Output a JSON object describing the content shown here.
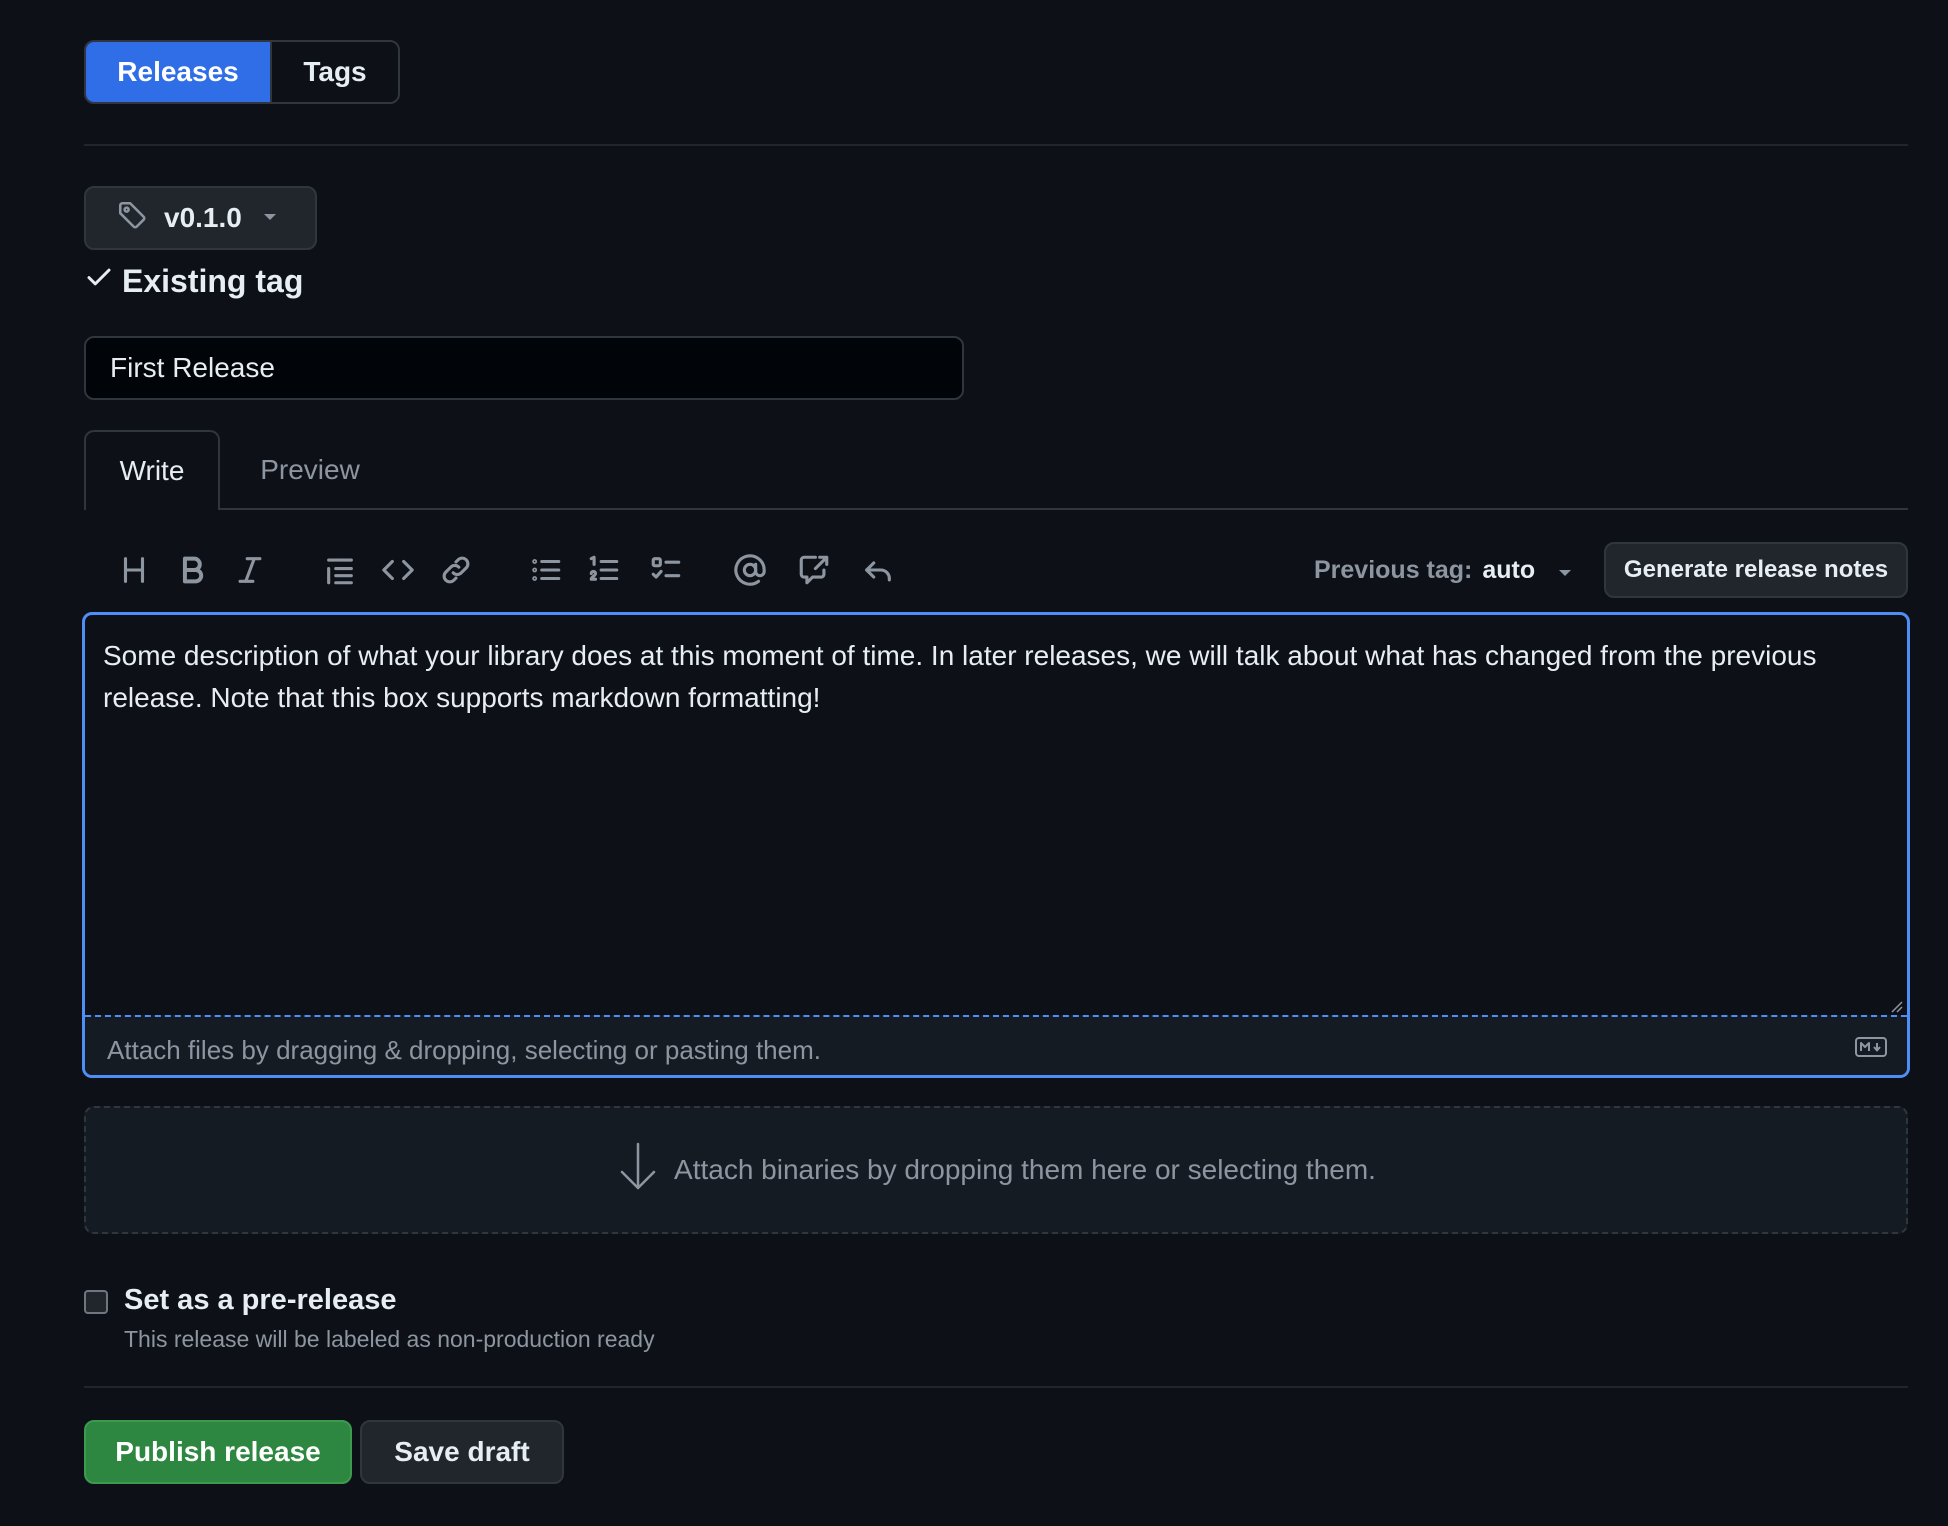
{
  "nav": {
    "releases_label": "Releases",
    "tags_label": "Tags",
    "active": "Releases"
  },
  "tag_picker": {
    "value": "v0.1.0",
    "icon": "tag-icon",
    "status_label": "Existing tag"
  },
  "release_title": {
    "value": "First Release"
  },
  "editor_tabs": {
    "write_label": "Write",
    "preview_label": "Preview",
    "active": "Write"
  },
  "toolbar": {
    "icons": [
      "heading-icon",
      "bold-icon",
      "italic-icon",
      "quote-icon",
      "code-icon",
      "link-icon",
      "bulleted-list-icon",
      "numbered-list-icon",
      "task-list-icon",
      "mention-icon",
      "reference-icon",
      "reply-icon"
    ],
    "previous_tag_label": "Previous tag:",
    "previous_tag_value": "auto",
    "generate_notes_label": "Generate release notes"
  },
  "editor": {
    "body": "Some description of what your library does at this moment of time. In later releases, we will talk about what has changed from the previous release. Note that this box supports markdown formatting!",
    "attach_hint": "Attach files by dragging & dropping, selecting or pasting them."
  },
  "binaries": {
    "hint": "Attach binaries by dropping them here or selecting them."
  },
  "prerelease": {
    "checked": false,
    "title": "Set as a pre-release",
    "description": "This release will be labeled as non-production ready"
  },
  "actions": {
    "publish_label": "Publish release",
    "draft_label": "Save draft"
  },
  "colors": {
    "background": "#0d1117",
    "accent_blue": "#2f6ee6",
    "focus_blue": "#4f8ef7",
    "publish_green": "#2e8740"
  }
}
